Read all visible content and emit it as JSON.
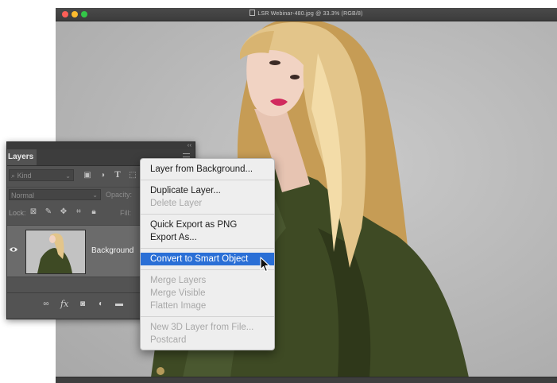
{
  "window": {
    "title": "LSR Webinar-480.jpg @ 33.3% (RGB/8)"
  },
  "layers_panel": {
    "tab_label": "Layers",
    "filter": {
      "kind_placeholder": "Kind"
    },
    "blend_mode": "Normal",
    "opacity_label": "Opacity:",
    "lock_label": "Lock:",
    "fill_label": "Fill:",
    "layer": {
      "name": "Background",
      "visible": true
    },
    "icons": {
      "filter": [
        "image-filter-icon",
        "adjustment-filter-icon",
        "type-filter-icon",
        "shape-filter-icon"
      ],
      "lock": [
        "lock-transparent-icon",
        "lock-paint-icon",
        "lock-move-icon",
        "lock-artboard-icon",
        "lock-all-icon"
      ],
      "footer": [
        "link-icon",
        "fx-icon",
        "mask-icon",
        "adjustment-icon",
        "folder-icon"
      ]
    }
  },
  "context_menu": {
    "items": [
      {
        "label": "Layer from Background...",
        "enabled": true
      },
      {
        "label": "Duplicate Layer...",
        "enabled": true
      },
      {
        "label": "Delete Layer",
        "enabled": false
      },
      {
        "label": "Quick Export as PNG",
        "enabled": true
      },
      {
        "label": "Export As...",
        "enabled": true
      },
      {
        "label": "Convert to Smart Object",
        "enabled": true,
        "highlighted": true
      },
      {
        "label": "Merge Layers",
        "enabled": false
      },
      {
        "label": "Merge Visible",
        "enabled": false
      },
      {
        "label": "Flatten Image",
        "enabled": false
      },
      {
        "label": "New 3D Layer from File...",
        "enabled": false
      },
      {
        "label": "Postcard",
        "enabled": false
      }
    ]
  },
  "colors": {
    "menu_highlight": "#2a6fd6",
    "panel_bg": "#535353",
    "jacket": "#3e4a24",
    "hair": "#e3c58a",
    "lips": "#d12a5e"
  }
}
